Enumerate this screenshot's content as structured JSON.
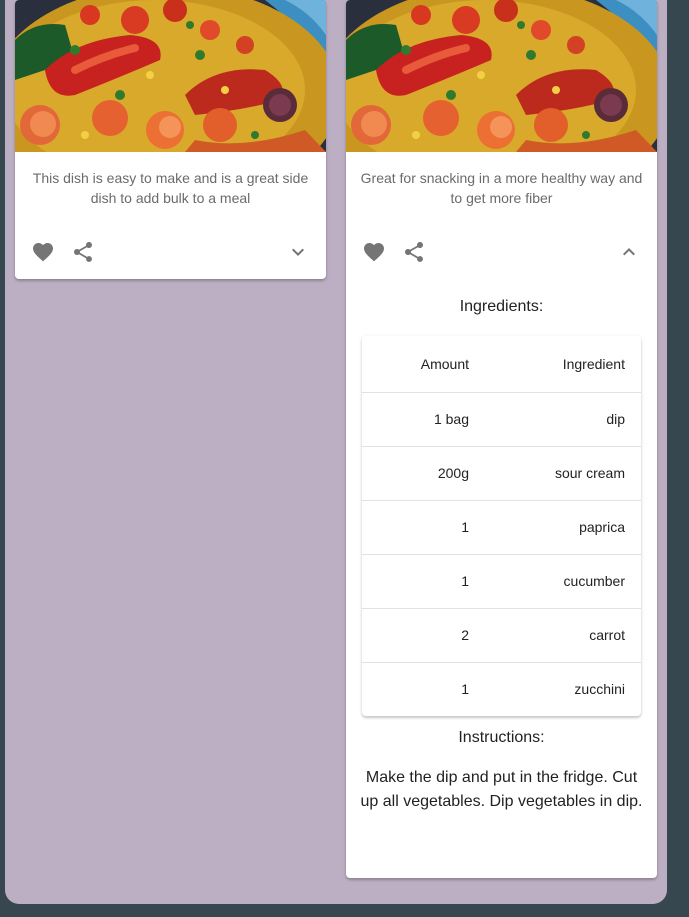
{
  "cards": [
    {
      "description": "This dish is easy to make and is a great side dish to add bulk to a meal",
      "expanded": false
    },
    {
      "description": "Great for snacking in a more healthy way and to get more fiber",
      "expanded": true,
      "ingredients_title": "Ingredients:",
      "table": {
        "headers": [
          "Amount",
          "Ingredient"
        ],
        "rows": [
          {
            "amount": "1 bag",
            "ingredient": "dip"
          },
          {
            "amount": "200g",
            "ingredient": "sour cream"
          },
          {
            "amount": "1",
            "ingredient": "paprica"
          },
          {
            "amount": "1",
            "ingredient": "cucumber"
          },
          {
            "amount": "2",
            "ingredient": "carrot"
          },
          {
            "amount": "1",
            "ingredient": "zucchini"
          }
        ]
      },
      "instructions_title": "Instructions:",
      "instructions": "Make the dip and put in the fridge. Cut up all vegetables. Dip vegetables in dip."
    }
  ],
  "icons": {
    "favorite": "heart-icon",
    "share": "share-icon",
    "expand": "chevron-down-icon",
    "collapse": "chevron-up-icon"
  },
  "colors": {
    "page_background": "#37474f",
    "panel_background": "#bdafc3",
    "card_background": "#ffffff",
    "icon_color": "#757575",
    "secondary_text": "#6b6b6b"
  }
}
